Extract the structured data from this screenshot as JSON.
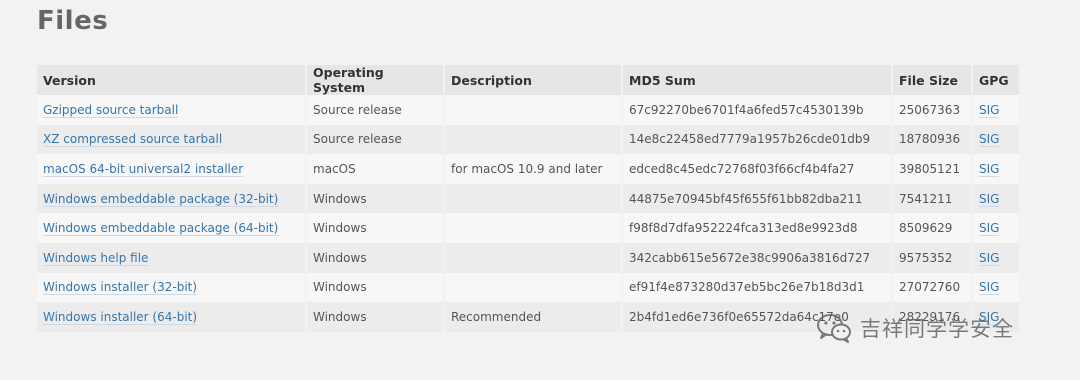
{
  "heading": "Files",
  "columns": [
    "Version",
    "Operating System",
    "Description",
    "MD5 Sum",
    "File Size",
    "GPG"
  ],
  "rows": [
    {
      "version": "Gzipped source tarball",
      "os": "Source release",
      "description": "",
      "md5": "67c92270be6701f4a6fed57c4530139b",
      "size": "25067363",
      "gpg": "SIG"
    },
    {
      "version": "XZ compressed source tarball",
      "os": "Source release",
      "description": "",
      "md5": "14e8c22458ed7779a1957b26cde01db9",
      "size": "18780936",
      "gpg": "SIG"
    },
    {
      "version": "macOS 64-bit universal2 installer",
      "os": "macOS",
      "description": "for macOS 10.9 and later",
      "md5": "edced8c45edc72768f03f66cf4b4fa27",
      "size": "39805121",
      "gpg": "SIG"
    },
    {
      "version": "Windows embeddable package (32-bit)",
      "os": "Windows",
      "description": "",
      "md5": "44875e70945bf45f655f61bb82dba211",
      "size": "7541211",
      "gpg": "SIG"
    },
    {
      "version": "Windows embeddable package (64-bit)",
      "os": "Windows",
      "description": "",
      "md5": "f98f8d7dfa952224fca313ed8e9923d8",
      "size": "8509629",
      "gpg": "SIG"
    },
    {
      "version": "Windows help file",
      "os": "Windows",
      "description": "",
      "md5": "342cabb615e5672e38c9906a3816d727",
      "size": "9575352",
      "gpg": "SIG"
    },
    {
      "version": "Windows installer (32-bit)",
      "os": "Windows",
      "description": "",
      "md5": "ef91f4e873280d37eb5bc26e7b18d3d1",
      "size": "27072760",
      "gpg": "SIG"
    },
    {
      "version": "Windows installer (64-bit)",
      "os": "Windows",
      "description": "Recommended",
      "md5": "2b4fd1ed6e736f0e65572da64c17e0",
      "size": "28229176",
      "gpg": "SIG"
    }
  ],
  "watermark": {
    "icon": "wechat-icon",
    "text": "吉祥同学学安全"
  },
  "colors": {
    "link": "#3776ab",
    "header_bg": "#e6e6e6",
    "row_odd": "#f7f7f7",
    "row_even": "#ececec"
  }
}
